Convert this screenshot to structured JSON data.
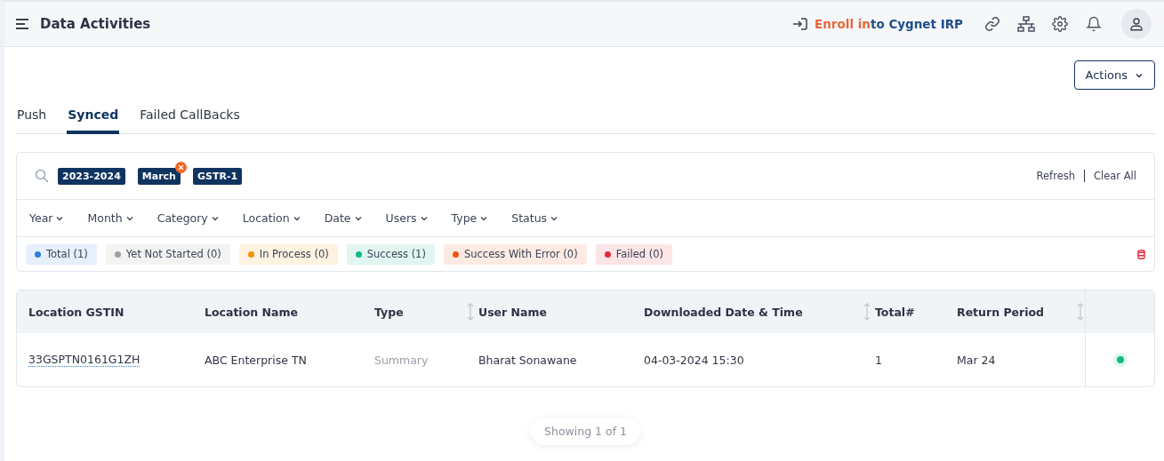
{
  "header": {
    "title": "Data Activities",
    "enroll_parts": [
      {
        "text": "Enroll in",
        "color": "#e8673c"
      },
      {
        "text": "to Cygnet IRP",
        "color": "#1f4e8c"
      }
    ]
  },
  "actions_button": "Actions",
  "tabs": [
    {
      "label": "Push",
      "selected": false
    },
    {
      "label": "Synced",
      "selected": true
    },
    {
      "label": "Failed CallBacks",
      "selected": false
    }
  ],
  "filter_chips": [
    {
      "label": "2023-2024",
      "removable": false
    },
    {
      "label": "March",
      "removable": true
    },
    {
      "label": "GSTR-1",
      "removable": false
    }
  ],
  "refresh": "Refresh",
  "clear_all": "Clear All",
  "dropdowns": [
    "Year",
    "Month",
    "Category",
    "Location",
    "Date",
    "Users",
    "Type",
    "Status"
  ],
  "status_pills": [
    {
      "label": "Total (1)",
      "color": "#2f7de1"
    },
    {
      "label": "Yet Not Started (0)",
      "color": "#9e9e9e"
    },
    {
      "label": "In Process (0)",
      "color": "#f5920a"
    },
    {
      "label": "Success (1)",
      "color": "#10b98a"
    },
    {
      "label": "Success With Error (0)",
      "color": "#f0521a"
    },
    {
      "label": "Failed (0)",
      "color": "#e4283a"
    }
  ],
  "table": {
    "columns": [
      {
        "label": "Location GSTIN",
        "sortable": false
      },
      {
        "label": "Location Name",
        "sortable": false
      },
      {
        "label": "Type",
        "sortable": true
      },
      {
        "label": "User Name",
        "sortable": false
      },
      {
        "label": "Downloaded Date & Time",
        "sortable": true
      },
      {
        "label": "Total#",
        "sortable": false
      },
      {
        "label": "Return Period",
        "sortable": true
      }
    ],
    "rows": [
      {
        "cells": [
          "33GSPTN0161G1ZH",
          "ABC Enterprise TN",
          "Summary",
          "Bharat Sonawane",
          "04-03-2024 15:30",
          "1",
          "Mar 24"
        ],
        "color": "#10b98a"
      }
    ]
  },
  "pagination": "Showing 1 of 1"
}
